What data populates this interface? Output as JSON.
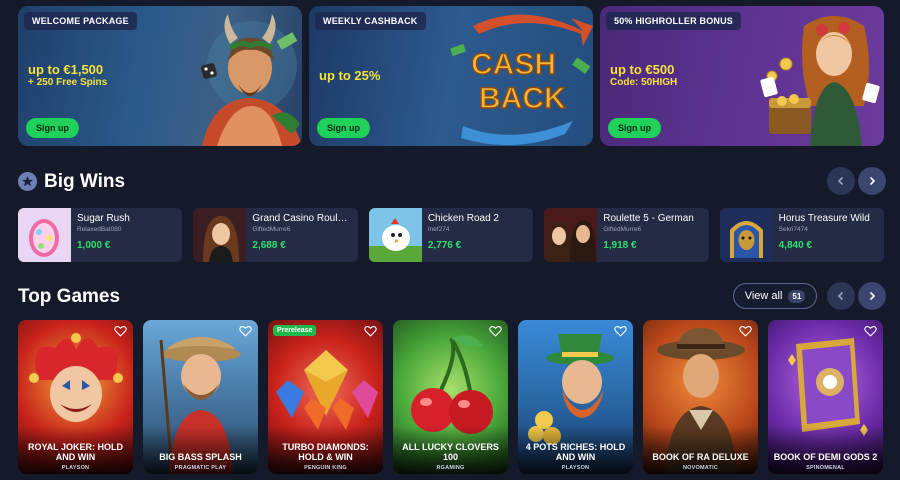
{
  "promos": [
    {
      "tag": "WELCOME PACKAGE",
      "headline": "up to €1,500",
      "sub": "+ 250 Free Spins",
      "button": "Sign up"
    },
    {
      "tag": "WEEKLY CASHBACK",
      "headline": "up to 25%",
      "sub": "",
      "button": "Sign up",
      "art_text_1": "CASH",
      "art_text_2": "BACK"
    },
    {
      "tag": "50% HIGHROLLER BONUS",
      "headline": "up to €500",
      "sub": "Code: 50HIGH",
      "button": "Sign up"
    }
  ],
  "big_wins": {
    "title": "Big Wins",
    "items": [
      {
        "game": "Sugar Rush",
        "user": "RelaxedBat080",
        "amount": "1,000 €"
      },
      {
        "game": "Grand Casino Roulette",
        "user": "GiftedMurre6",
        "amount": "2,688 €"
      },
      {
        "game": "Chicken Road 2",
        "user": "Inef274",
        "amount": "2,776 €"
      },
      {
        "game": "Roulette 5 - German",
        "user": "GiftedMurre6",
        "amount": "1,918 €"
      },
      {
        "game": "Horus Treasure Wild",
        "user": "Sekri7474",
        "amount": "4,840 €"
      }
    ]
  },
  "top_games": {
    "title": "Top Games",
    "view_all_label": "View all",
    "view_all_count": "51",
    "prerelease_label": "Prerelease",
    "items": [
      {
        "title": "ROYAL JOKER: HOLD AND WIN",
        "provider": "PLAYSON"
      },
      {
        "title": "BIG BASS SPLASH",
        "provider": "PRAGMATIC PLAY"
      },
      {
        "title": "TURBO DIAMONDS: HOLD & WIN",
        "provider": "PENGUIN KING"
      },
      {
        "title": "ALL LUCKY CLOVERS 100",
        "provider": "RGAMING"
      },
      {
        "title": "4 POTS RICHES: HOLD AND WIN",
        "provider": "PLAYSON"
      },
      {
        "title": "BOOK OF RA DELUXE",
        "provider": "NOVOMATIC"
      },
      {
        "title": "BOOK OF DEMI GODS 2",
        "provider": "SPINOMENAL"
      }
    ]
  },
  "colors": {
    "accent_green": "#1fd05a",
    "win_amount": "#2fe06a",
    "promo_text": "#f5e33a",
    "background": "#151a2b"
  }
}
